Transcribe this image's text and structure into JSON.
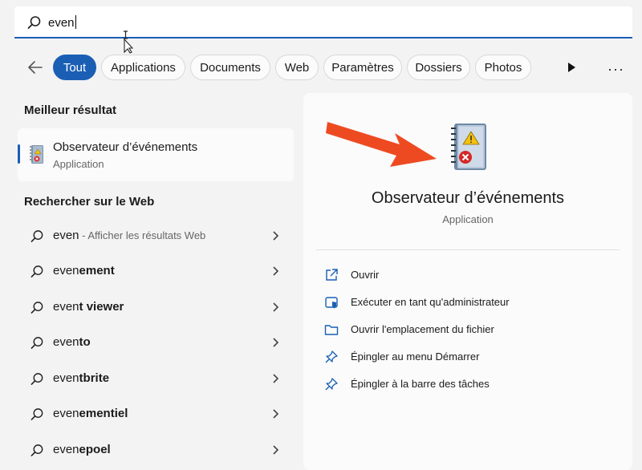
{
  "search": {
    "query": "even"
  },
  "filters": {
    "items": [
      {
        "label": "Tout",
        "active": true
      },
      {
        "label": "Applications"
      },
      {
        "label": "Documents"
      },
      {
        "label": "Web"
      },
      {
        "label": "Paramètres"
      },
      {
        "label": "Dossiers"
      },
      {
        "label": "Photos"
      }
    ],
    "more": "···"
  },
  "best": {
    "section": "Meilleur résultat",
    "title": "Observateur d’événements",
    "subtitle": "Application"
  },
  "web": {
    "section": "Rechercher sur le Web",
    "items": [
      {
        "prefix": "even",
        "suffix": "",
        "hint": " - Afficher les résultats Web"
      },
      {
        "prefix": "even",
        "suffix": "ement",
        "hint": ""
      },
      {
        "prefix": "even",
        "suffix": "t viewer",
        "hint": ""
      },
      {
        "prefix": "even",
        "suffix": "to",
        "hint": ""
      },
      {
        "prefix": "even",
        "suffix": "tbrite",
        "hint": ""
      },
      {
        "prefix": "even",
        "suffix": "ementiel",
        "hint": ""
      },
      {
        "prefix": "even",
        "suffix": "epoel",
        "hint": ""
      }
    ]
  },
  "detail": {
    "title": "Observateur d’événements",
    "subtitle": "Application",
    "actions": [
      {
        "label": "Ouvrir",
        "icon": "open-external-icon"
      },
      {
        "label": "Exécuter en tant qu'administrateur",
        "icon": "admin-shield-icon"
      },
      {
        "label": "Ouvrir l'emplacement du fichier",
        "icon": "folder-icon"
      },
      {
        "label": "Épingler au menu Démarrer",
        "icon": "pin-icon"
      },
      {
        "label": "Épingler à la barre des tâches",
        "icon": "pin-icon"
      }
    ]
  },
  "colors": {
    "accent": "#1a5fb4",
    "annotation_arrow": "#ee4a22"
  }
}
